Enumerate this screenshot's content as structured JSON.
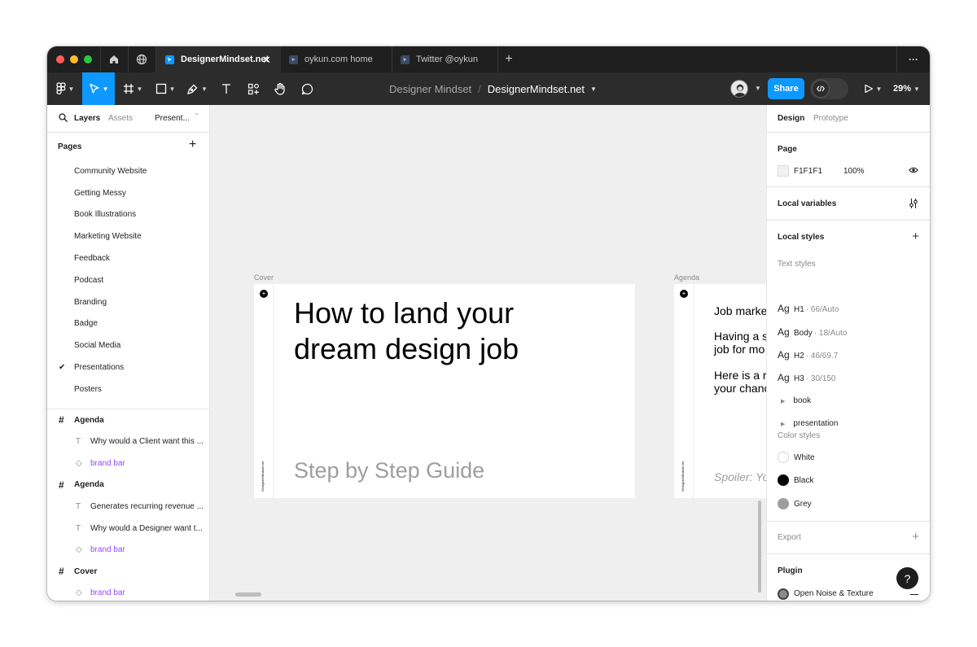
{
  "tabs": [
    {
      "label": "DesignerMindset.net",
      "close": "✕"
    },
    {
      "label": "oykun.com home"
    },
    {
      "label": "Twitter @oykun"
    }
  ],
  "new_tab": "+",
  "more_menu": "···",
  "toolbar": {
    "project": "Designer Mindset",
    "separator": "/",
    "file": "DesignerMindset.net",
    "share_label": "Share",
    "zoom": "29%"
  },
  "left_panel": {
    "tabs": {
      "layers": "Layers",
      "assets": "Assets",
      "page": "Present..."
    },
    "pages_heading": "Pages",
    "pages": [
      "Community Website",
      "Getting Messy",
      "Book Illustrations",
      "Marketing Website",
      "Feedback",
      "Podcast",
      "Branding",
      "Badge",
      "Social Media",
      "Presentations",
      "Posters"
    ],
    "current_page_index": 9,
    "layers": [
      {
        "type": "frame",
        "label": "Agenda"
      },
      {
        "type": "text",
        "label": "Why would a Client want this ..."
      },
      {
        "type": "component",
        "label": "brand bar"
      },
      {
        "type": "frame",
        "label": "Agenda"
      },
      {
        "type": "text",
        "label": "Generates recurring revenue ..."
      },
      {
        "type": "text",
        "label": "Why would a Designer want t..."
      },
      {
        "type": "component",
        "label": "brand bar"
      },
      {
        "type": "frame",
        "label": "Cover"
      },
      {
        "type": "component",
        "label": "brand bar"
      }
    ]
  },
  "canvas": {
    "cover": {
      "label": "Cover",
      "title": "How to land your dream design job",
      "subtitle": "Step by Step Guide",
      "brand": "DesignerMindset.net"
    },
    "agenda": {
      "label": "Agenda",
      "lines": [
        "Job marke",
        "Having a s",
        "job for mo",
        "Here is a r",
        "your chanc"
      ],
      "spoiler": "Spoiler: Yo",
      "brand": "DesignerMindset.net"
    }
  },
  "right_panel": {
    "tabs": {
      "design": "Design",
      "prototype": "Prototype"
    },
    "page": {
      "title": "Page",
      "color": "F1F1F1",
      "opacity": "100%",
      "swatch": "#F1F1F1"
    },
    "local_variables": "Local variables",
    "local_styles": "Local styles",
    "text_styles_heading": "Text styles",
    "text_styles": [
      {
        "ag": "Ag",
        "name": "H1",
        "meta": " · 66/Auto"
      },
      {
        "ag": "Ag",
        "name": "Body",
        "meta": " · 18/Auto"
      },
      {
        "ag": "Ag",
        "name": "H2",
        "meta": " · 46/69.7"
      },
      {
        "ag": "Ag",
        "name": "H3",
        "meta": " · 30/150"
      }
    ],
    "style_groups": [
      "book",
      "presentation"
    ],
    "color_styles_heading": "Color styles",
    "color_styles": [
      {
        "name": "White",
        "hex": "#FFFFFF"
      },
      {
        "name": "Black",
        "hex": "#000000"
      },
      {
        "name": "Grey",
        "hex": "#9E9E9E"
      }
    ],
    "export": "Export",
    "plugin": "Plugin",
    "plugin_item": "Open Noise & Texture"
  },
  "help": "?",
  "colors": {
    "accent": "#0D99FF",
    "component": "#9747FF",
    "toolbar": "#2C2C2C"
  }
}
